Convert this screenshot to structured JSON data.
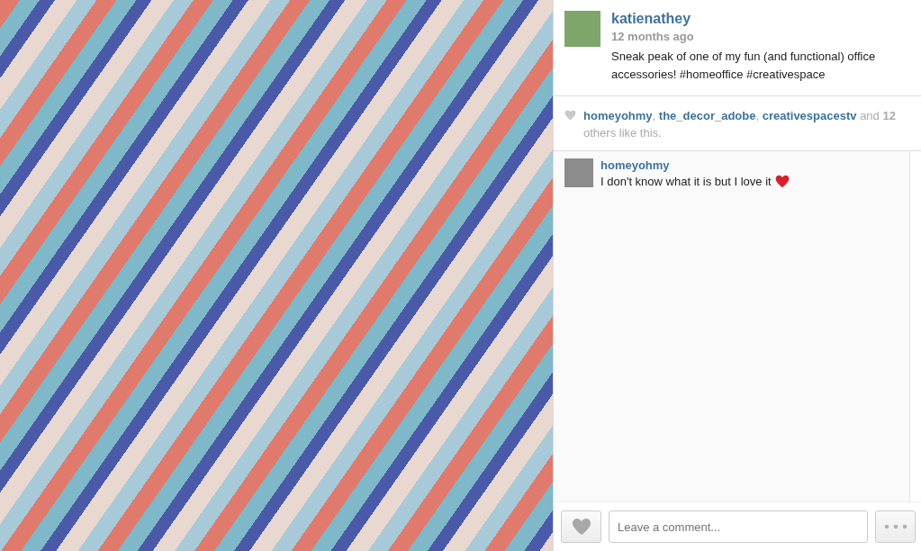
{
  "post": {
    "username": "katienathey",
    "time": "12 months ago",
    "caption": "Sneak peak of one of my fun (and functional) office accessories! #homeoffice #creativespace"
  },
  "likes": {
    "liked": false,
    "users": [
      "homeyohmy",
      "the_decor_adobe",
      "creativespacestv"
    ],
    "separator": ",",
    "and": "and",
    "count": "12",
    "suffix": "others like this."
  },
  "comments": [
    {
      "username": "homeyohmy",
      "text": "I don't know what it is but I love it",
      "emoji": true
    }
  ],
  "comment_field": {
    "placeholder": "Leave a comment..."
  }
}
